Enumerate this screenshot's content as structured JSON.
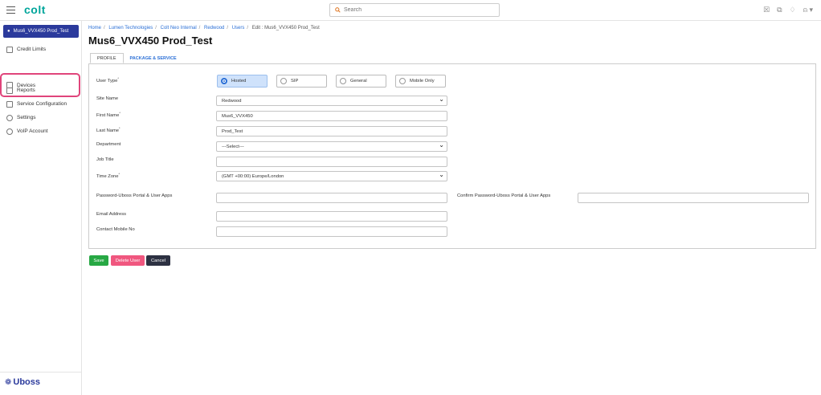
{
  "topbar": {
    "logo": "colt",
    "search_placeholder": "Search",
    "icons": [
      "bell-icon",
      "export-icon",
      "notification-icon",
      "user-icon"
    ]
  },
  "sidebar": {
    "user_button": "Mus6_VVX450 Prod_Test",
    "items": [
      {
        "label": "Credit Limits",
        "icon": "credit-icon"
      },
      {
        "label": "Devices",
        "icon": "devices-icon"
      },
      {
        "label": "Reports",
        "icon": "reports-icon"
      },
      {
        "label": "Service Configuration",
        "icon": "service-icon"
      },
      {
        "label": "Settings",
        "icon": "gear-icon"
      },
      {
        "label": "VoIP Account",
        "icon": "voip-icon"
      }
    ],
    "footer_logo": "Uboss"
  },
  "breadcrumb": {
    "items": [
      "Home",
      "Lumen Technologies",
      "Colt Neo Internal",
      "Redwood",
      "Users"
    ],
    "current": "Edit : Mus6_VVX450 Prod_Test"
  },
  "page_title": "Mus6_VVX450 Prod_Test",
  "tabs": [
    "PROFILE",
    "PACKAGE & SERVICE"
  ],
  "form": {
    "user_type_label": "User Type",
    "user_types": [
      "Hosted",
      "SIP",
      "General",
      "Mobile Only"
    ],
    "selected_user_type": "Hosted",
    "site_name_label": "Site Name",
    "site_name": "Redwood",
    "first_name_label": "First Name",
    "first_name": "Mus6_VVX450",
    "last_name_label": "Last Name",
    "last_name": "Prod_Test",
    "department_label": "Department",
    "department": "---Select---",
    "job_title_label": "Job Title",
    "job_title": "",
    "time_zone_label": "Time Zone",
    "time_zone": "(GMT +00:00) Europe/London",
    "password_label": "Password-Uboss Portal & User Apps",
    "confirm_password_label": "Confirm Password-Uboss Portal & User Apps",
    "email_label": "Email Address",
    "mobile_label": "Contact Mobile No"
  },
  "actions": {
    "save": "Save",
    "delete": "Delete User",
    "cancel": "Cancel"
  },
  "colors": {
    "primary": "#2b3a9c",
    "accent": "#00a59b",
    "save": "#27a844",
    "delete": "#f0577f",
    "cancel": "#2d3142",
    "highlight": "#e0457b"
  }
}
